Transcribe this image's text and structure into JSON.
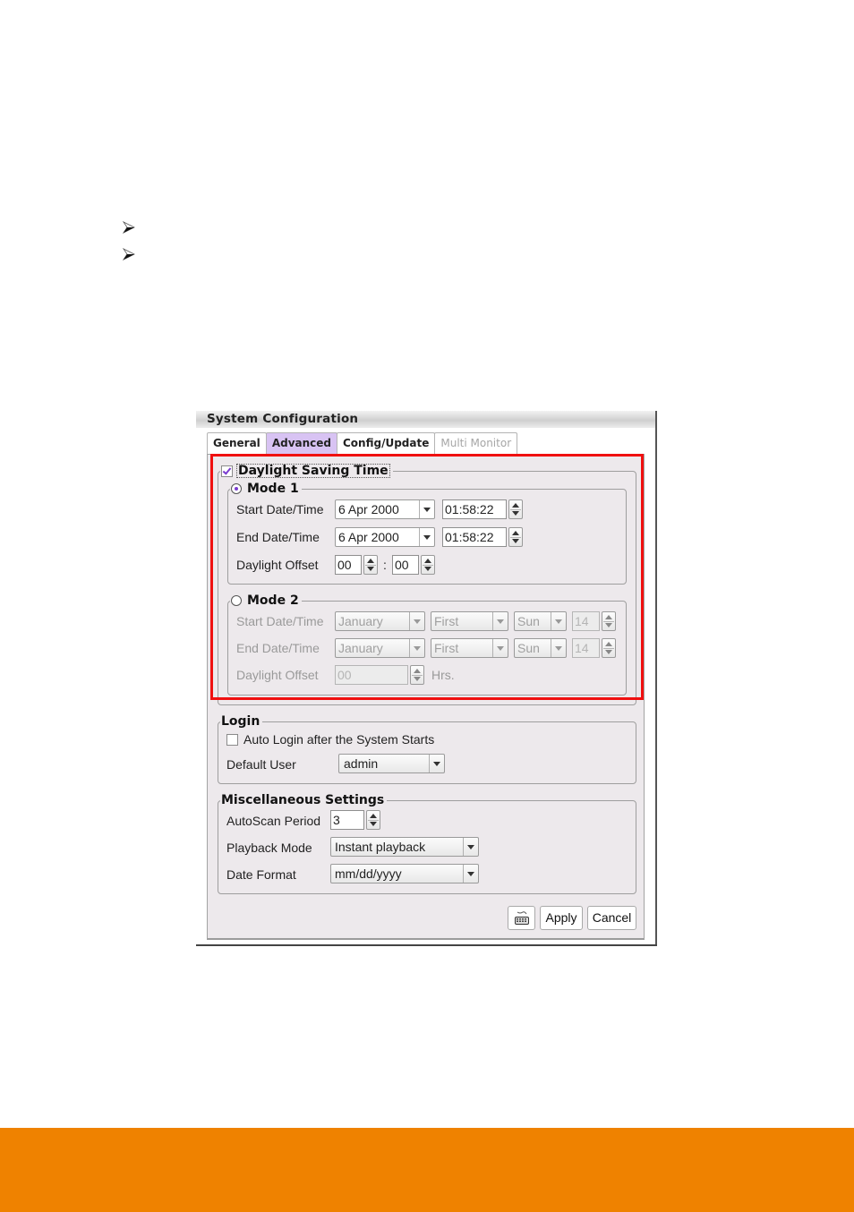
{
  "page": {
    "bullets": [
      "arrow-bullet",
      "arrow-bullet"
    ],
    "footer_color": "#ef8200",
    "highlight_color": "#f01010"
  },
  "window": {
    "title": "System Configuration",
    "tabs": [
      {
        "label": "General",
        "state": "normal"
      },
      {
        "label": "Advanced",
        "state": "active"
      },
      {
        "label": "Config/Update",
        "state": "normal"
      },
      {
        "label": "Multi Monitor",
        "state": "disabled"
      }
    ]
  },
  "dst": {
    "title": "Daylight Saving Time",
    "enabled": true,
    "mode1": {
      "label": "Mode 1",
      "selected": true,
      "start_label": "Start Date/Time",
      "start_date": "6 Apr 2000",
      "start_time": "01:58:22",
      "end_label": "End Date/Time",
      "end_date": "6 Apr 2000",
      "end_time": "01:58:22",
      "offset_label": "Daylight Offset",
      "offset_hours": "00",
      "offset_sep": ":",
      "offset_minutes": "00"
    },
    "mode2": {
      "label": "Mode 2",
      "selected": false,
      "start_label": "Start Date/Time",
      "start_month": "January",
      "start_week": "First",
      "start_day": "Sun",
      "start_hour": "14",
      "end_label": "End Date/Time",
      "end_month": "January",
      "end_week": "First",
      "end_day": "Sun",
      "end_hour": "14",
      "offset_label": "Daylight Offset",
      "offset_value": "00",
      "offset_unit": "Hrs."
    }
  },
  "login": {
    "title": "Login",
    "auto_login_label": "Auto Login after the System Starts",
    "auto_login_checked": false,
    "default_user_label": "Default User",
    "default_user_value": "admin"
  },
  "misc": {
    "title": "Miscellaneous Settings",
    "autoscan_label": "AutoScan Period",
    "autoscan_value": "3",
    "playback_label": "Playback Mode",
    "playback_value": "Instant playback",
    "date_format_label": "Date Format",
    "date_format_value": "mm/dd/yyyy"
  },
  "buttons": {
    "keyboard_icon": "keyboard-icon",
    "apply": "Apply",
    "cancel": "Cancel"
  }
}
